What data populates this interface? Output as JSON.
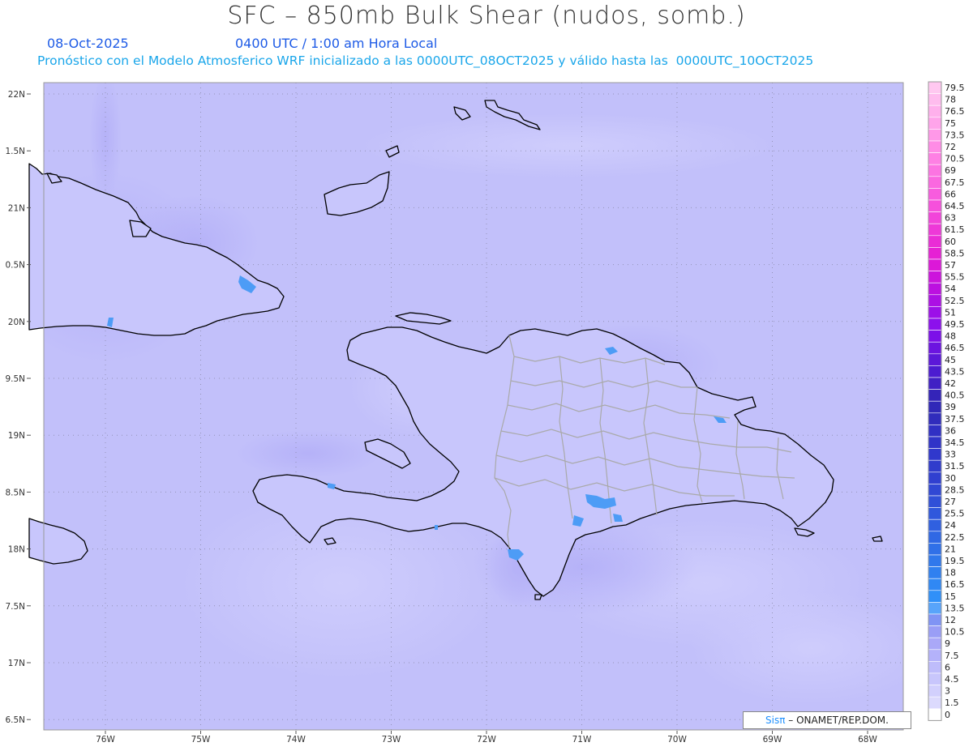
{
  "header": {
    "title": "SFC – 850mb Bulk Shear (nudos, somb.)",
    "date": "08-Oct-2025",
    "time": "0400 UTC / 1:00 am Hora Local",
    "description": "Pronóstico con el Modelo Atmosferico WRF inicializado a las 0000UTC_08OCT2025 y válido hasta las  0000UTC_10OCT2025"
  },
  "map": {
    "lat_labels": [
      "22N",
      "1.5N",
      "21N",
      "0.5N",
      "20N",
      "9.5N",
      "19N",
      "8.5N",
      "18N",
      "7.5N",
      "17N",
      "6.5N"
    ],
    "lon_labels": [
      "76W",
      "75W",
      "74W",
      "73W",
      "72W",
      "71W",
      "70W",
      "69W",
      "68W"
    ]
  },
  "colorbar": {
    "labels": [
      "79.5",
      "78",
      "76.5",
      "75",
      "73.5",
      "72",
      "70.5",
      "69",
      "67.5",
      "66",
      "64.5",
      "63",
      "61.5",
      "60",
      "58.5",
      "57",
      "55.5",
      "54",
      "52.5",
      "51",
      "49.5",
      "48",
      "46.5",
      "45",
      "43.5",
      "42",
      "40.5",
      "39",
      "37.5",
      "36",
      "34.5",
      "33",
      "31.5",
      "30",
      "28.5",
      "27",
      "25.5",
      "24",
      "22.5",
      "21",
      "19.5",
      "18",
      "16.5",
      "15",
      "13.5",
      "12",
      "10.5",
      "9",
      "7.5",
      "6",
      "4.5",
      "3",
      "1.5",
      "0"
    ],
    "colors": [
      "#ffc8f0",
      "#ffbcee",
      "#ffb0ec",
      "#ffa4ea",
      "#ff98e8",
      "#ff8ce6",
      "#fe80e4",
      "#fc74e2",
      "#fa68e0",
      "#f85cde",
      "#f650dc",
      "#f244da",
      "#ee38d8",
      "#ea2cd6",
      "#e620d4",
      "#dc18d8",
      "#cc14dc",
      "#bc10e0",
      "#ac10e4",
      "#9c10e8",
      "#8c10ec",
      "#7c10e8",
      "#6c14e0",
      "#5c18d8",
      "#4c1cd0",
      "#4020c4",
      "#3424b8",
      "#3028b8",
      "#302cbc",
      "#3030c4",
      "#3034c8",
      "#3038cc",
      "#303ccc",
      "#3040d0",
      "#3048d4",
      "#3050d8",
      "#3058dc",
      "#3060e0",
      "#3068e4",
      "#3070e8",
      "#3078ec",
      "#3080f0",
      "#3088f4",
      "#3090f8",
      "#58a4fa",
      "#8094f4",
      "#9a9ef6",
      "#aaa8f8",
      "#b4b2fa",
      "#bebcfb",
      "#c8c6fc",
      "#d2d0fd",
      "#dcdafd",
      "#ffffff"
    ]
  },
  "credit": {
    "brand": "Sisπ",
    "text": " – ONAMET/REP.DOM."
  }
}
